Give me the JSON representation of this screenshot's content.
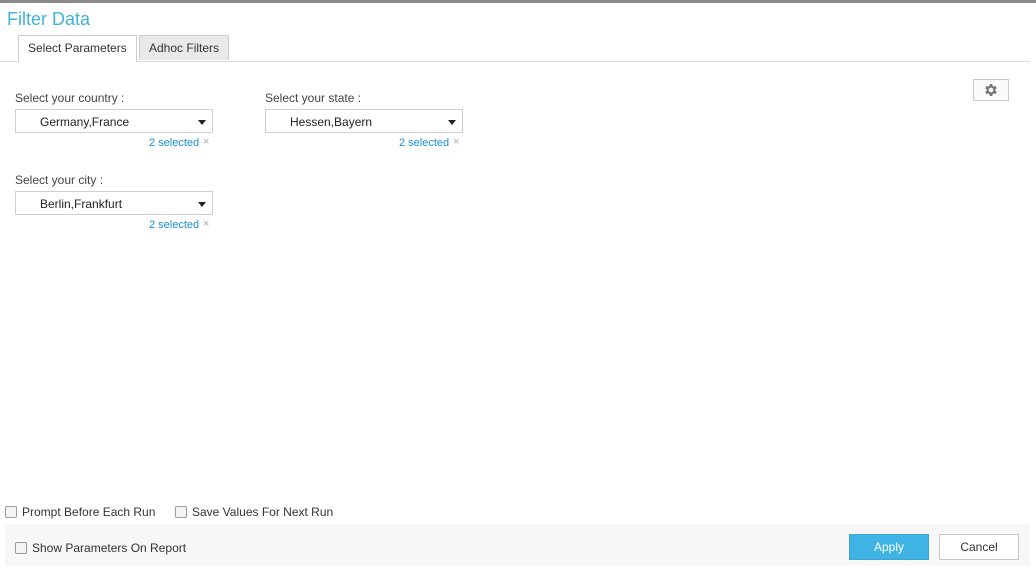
{
  "title": "Filter Data",
  "tabs": [
    {
      "label": "Select Parameters",
      "active": true
    },
    {
      "label": "Adhoc Filters",
      "active": false
    }
  ],
  "settings_icon": "gear-icon",
  "filters": {
    "country": {
      "label": "Select your country :",
      "value": "Germany,France",
      "selected_text": "2 selected",
      "clear": "×"
    },
    "state": {
      "label": "Select your state :",
      "value": "Hessen,Bayern",
      "selected_text": "2 selected",
      "clear": "×"
    },
    "city": {
      "label": "Select your city :",
      "value": "Berlin,Frankfurt",
      "selected_text": "2 selected",
      "clear": "×"
    }
  },
  "options": {
    "prompt_before_run": "Prompt Before Each Run",
    "save_values": "Save Values For Next Run",
    "show_params": "Show Parameters On Report"
  },
  "buttons": {
    "apply": "Apply",
    "cancel": "Cancel"
  },
  "colors": {
    "accent": "#3fb3d8",
    "apply_bg": "#3fb3e3",
    "link": "#1a8fd6"
  }
}
